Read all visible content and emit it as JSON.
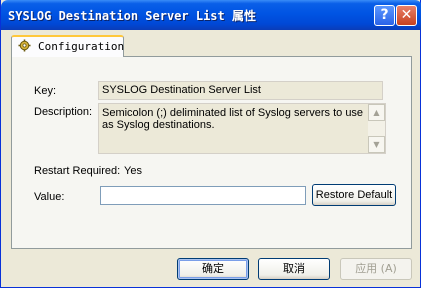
{
  "window": {
    "title": "SYSLOG Destination Server List 属性",
    "help_glyph": "?",
    "close_glyph": "✕"
  },
  "tabs": [
    {
      "label": "Configuration",
      "icon": "gear-icon"
    }
  ],
  "config": {
    "key_label": "Key:",
    "key_value": "SYSLOG Destination Server List",
    "description_label": "Description:",
    "description_value": "Semicolon (;) deliminated list of Syslog servers to use as Syslog destinations.",
    "restart_label": "Restart Required:",
    "restart_value": "Yes",
    "value_label": "Value:",
    "value_current": "",
    "restore_default_label": "Restore Default"
  },
  "buttons": {
    "ok": "确定",
    "cancel": "取消",
    "apply": "应用 (A)"
  }
}
